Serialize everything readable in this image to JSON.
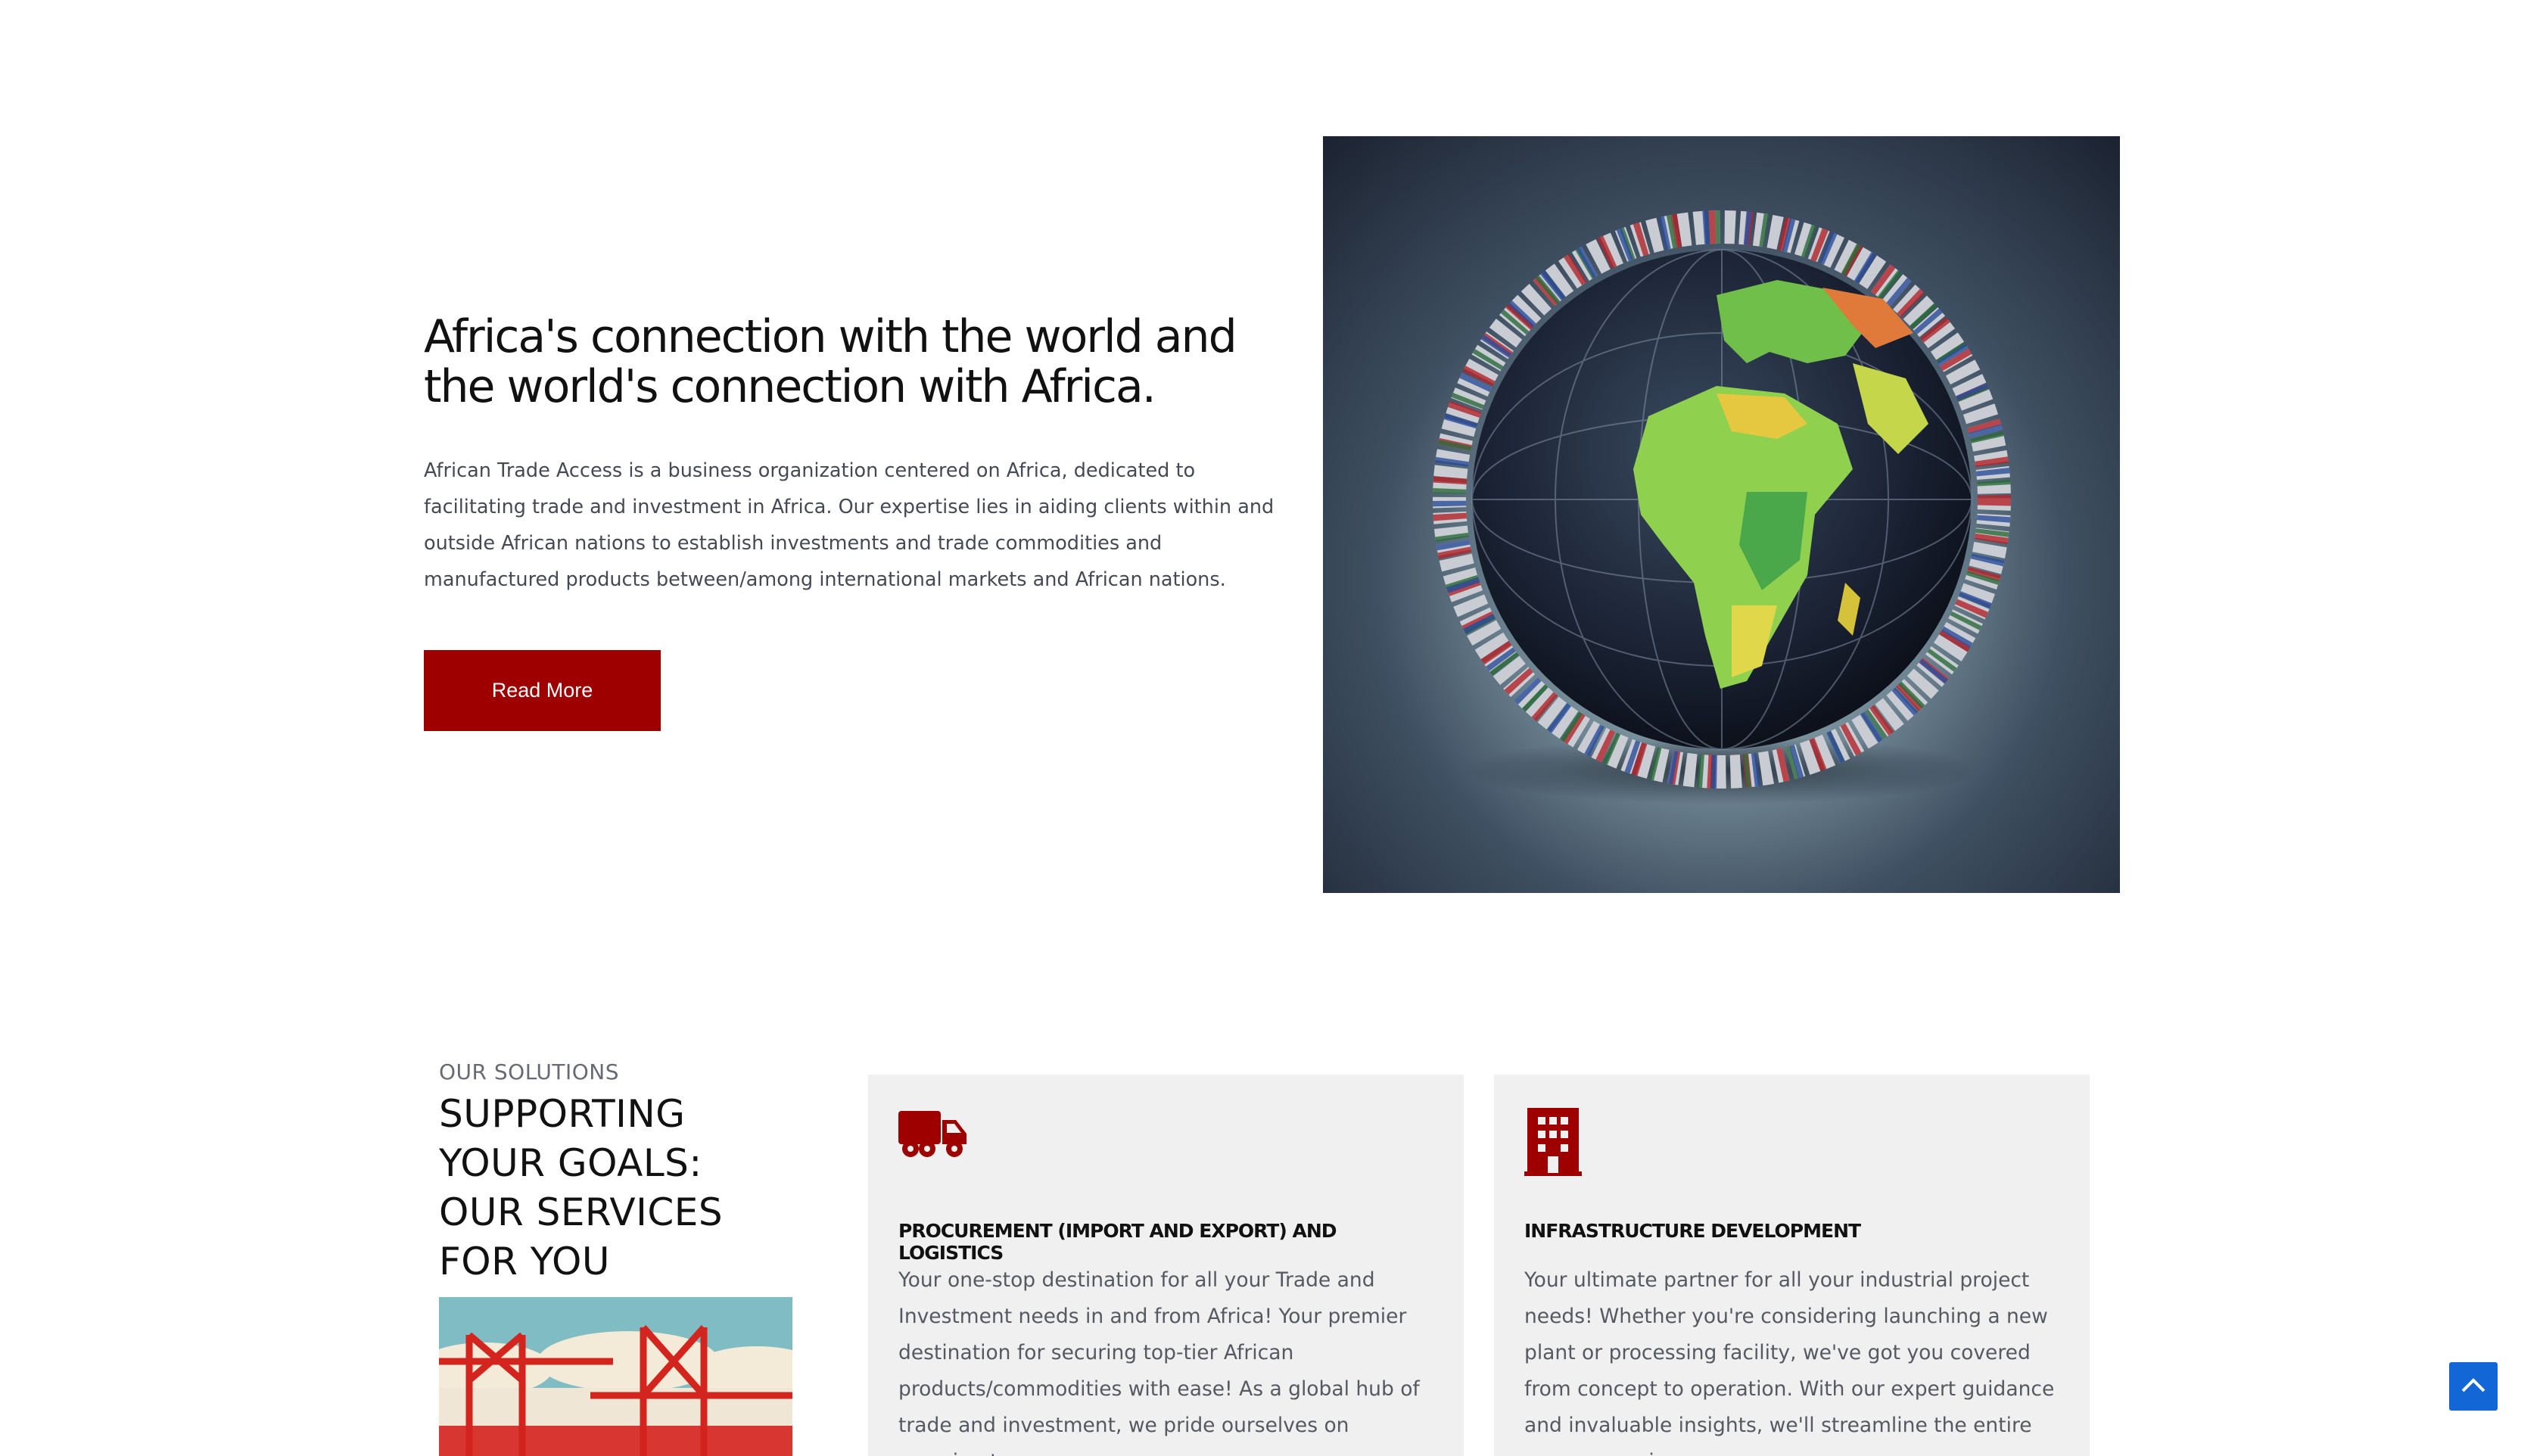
{
  "hero": {
    "title": "Africa's connection with the world and the world's connection with Africa.",
    "description": "African Trade Access is a business organization centered on Africa, dedicated to facilitating trade and investment in Africa. Our expertise lies in aiding clients within and outside African nations to establish investments and trade commodities and manufactured products between/among international markets and African nations.",
    "button_label": "Read More",
    "button_color": "#9e0000"
  },
  "solutions": {
    "eyebrow": "OUR SOLUTIONS",
    "title": "SUPPORTING YOUR GOALS: OUR SERVICES FOR YOU",
    "cards": [
      {
        "icon": "truck-icon",
        "title": "PROCUREMENT (IMPORT AND EXPORT) AND LOGISTICS",
        "text": "Your one-stop destination for all your Trade and Investment needs in and from Africa! Your premier destination for securing top-tier African products/commodities with ease! As a global hub of trade and investment, we pride ourselves on sourcing top-"
      },
      {
        "icon": "building-icon",
        "title": "INFRASTRUCTURE DEVELOPMENT",
        "text": "Your ultimate partner for all your industrial project needs! Whether you're considering launching a new plant or processing facility, we've got you covered from concept to operation. With our expert guidance and invaluable insights, we'll streamline the entire process, saving you"
      }
    ]
  },
  "scroll_top_icon": "chevron-up-icon",
  "accent_color": "#9e0000",
  "scroll_button_color": "#1366d6"
}
